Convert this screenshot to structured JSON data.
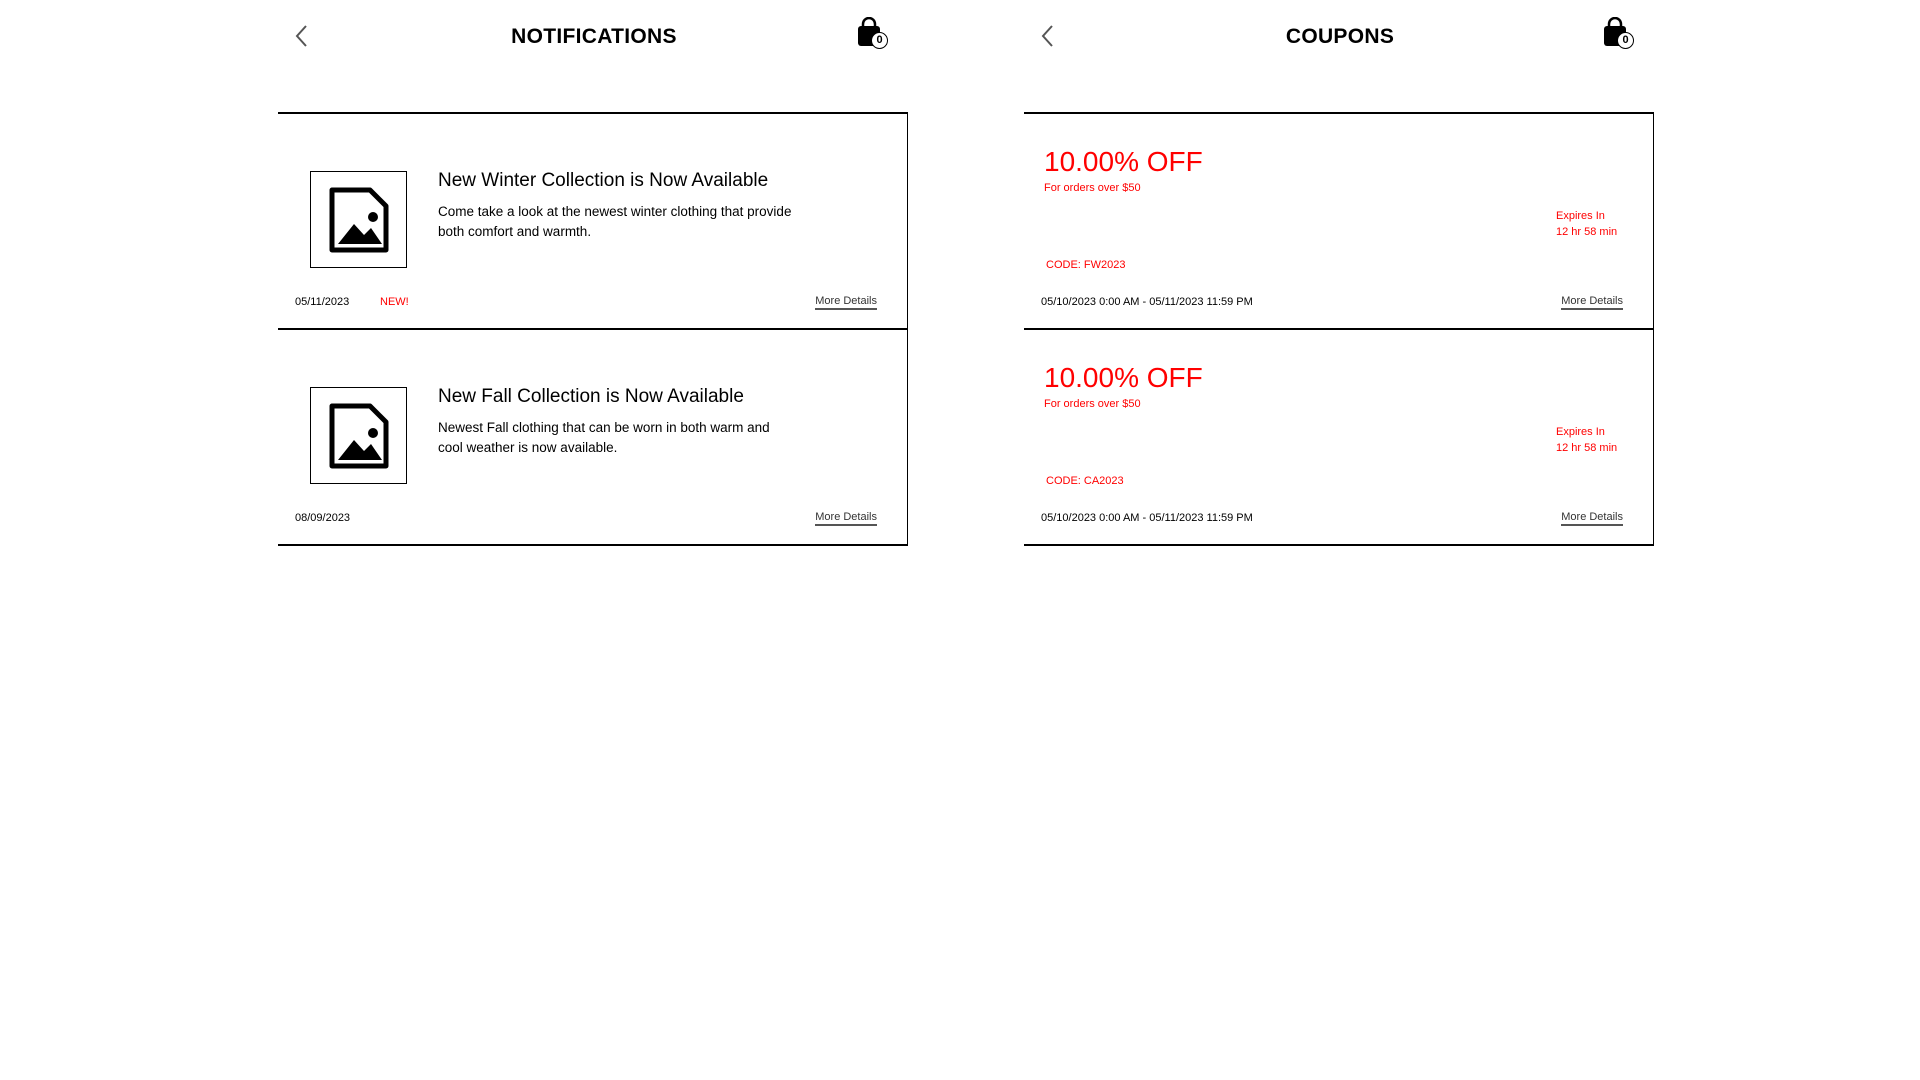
{
  "notifications": {
    "title": "NOTIFICATIONS",
    "bag_count": "0",
    "items": [
      {
        "title": "New Winter Collection is Now Available",
        "description": "Come take a look at the newest winter clothing that provide both comfort and warmth.",
        "date": "05/11/2023",
        "badge": "NEW!",
        "link": "More Details"
      },
      {
        "title": "New Fall Collection is Now Available",
        "description": "Newest Fall clothing that can be worn in both warm and cool weather is now available.",
        "date": "08/09/2023",
        "link": "More Details"
      }
    ]
  },
  "coupons": {
    "title": "COUPONS",
    "bag_count": "0",
    "items": [
      {
        "amount": "10.00% OFF",
        "minimum": "For orders over $50",
        "expires_label": "Expires In",
        "expires_value": "12 hr 58 min",
        "code": "CODE: FW2023",
        "valid_range": "05/10/2023 0:00 AM - 05/11/2023 11:59 PM",
        "link": "More Details"
      },
      {
        "amount": "10.00% OFF",
        "minimum": "For orders over $50",
        "expires_label": "Expires In",
        "expires_value": "12 hr 58 min",
        "code": "CODE: CA2023",
        "valid_range": "05/10/2023 0:00 AM - 05/11/2023 11:59 PM",
        "link": "More Details"
      }
    ]
  },
  "colors": {
    "accent": "#ff0000",
    "text": "#000000",
    "background": "#ffffff"
  },
  "icons": [
    "back-chevron-icon",
    "shopping-bag-icon",
    "image-placeholder-icon"
  ]
}
